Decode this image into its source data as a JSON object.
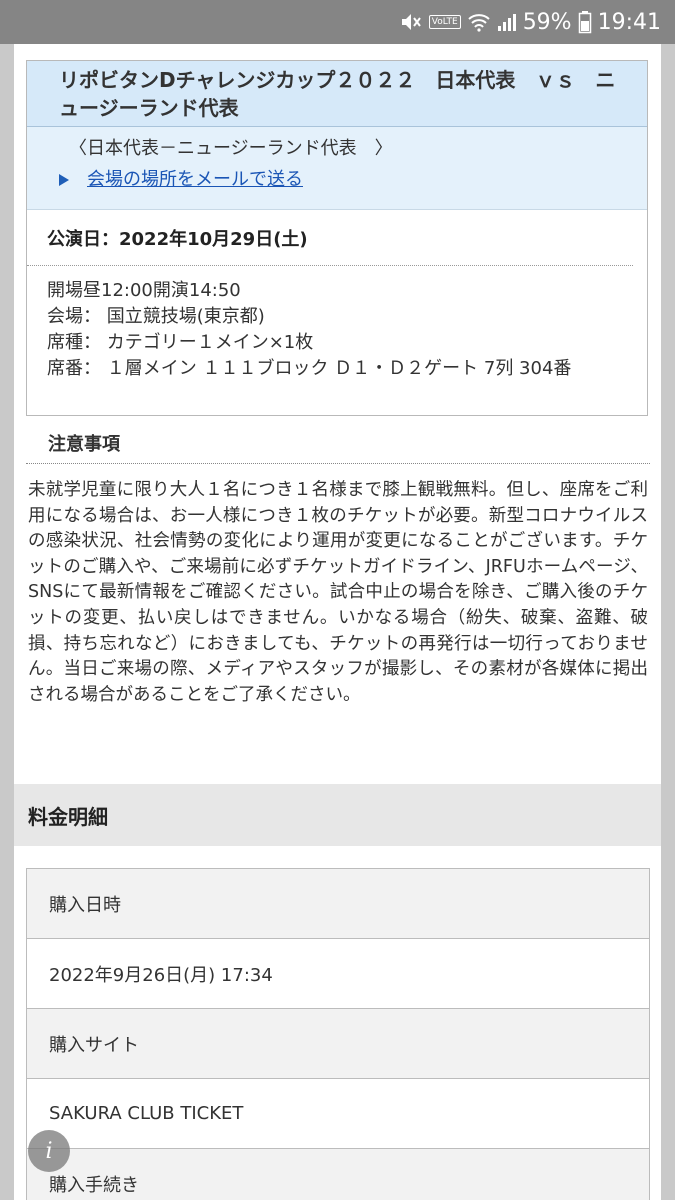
{
  "status_bar": {
    "volte": "VoLTE",
    "battery_pct": "59%",
    "time": "19:41",
    "icons": [
      "mute-icon",
      "volte-icon",
      "wifi-icon",
      "signal-icon",
      "battery-icon"
    ]
  },
  "ticket": {
    "title": "リポビタンDチャレンジカップ２０２２　日本代表　ｖｓ　ニュージーランド代表",
    "matchup": "〈日本代表－ニュージーランド代表　〉",
    "mail_link": "会場の場所をメールで送る",
    "date": "公演日：2022年10月29日(土)",
    "info": {
      "open": "開場昼12:00開演14:50",
      "venue": "会場：  国立競技場(東京都)",
      "seat_type": "席種：  カテゴリー１メイン×1枚",
      "seat_no": "席番：  １層メイン  １１１ブロック  Ｄ１・Ｄ２ゲート  7列 304番"
    }
  },
  "notes": {
    "heading": "注意事項",
    "body": "未就学児童に限り大人１名につき１名様まで膝上観戦無料。但し、座席をご利用になる場合は、お一人様につき１枚のチケットが必要。新型コロナウイルスの感染状況、社会情勢の変化により運用が変更になることがございます。チケットのご購入や、ご来場前に必ずチケットガイドライン、JRFUホームページ、SNSにて最新情報をご確認ください。試合中止の場合を除き、ご購入後のチケットの変更、払い戻しはできません。いかなる場合（紛失、破棄、盗難、破損、持ち忘れなど）におきましても、チケットの再発行は一切行っておりません。当日ご来場の際、メディアやスタッフが撮影し、その素材が各媒体に掲出される場合があることをご了承ください。"
  },
  "fee": {
    "heading": "料金明細",
    "rows": [
      {
        "label": "購入日時",
        "value": "2022年9月26日(月) 17:34"
      },
      {
        "label": "購入サイト",
        "value": "SAKURA CLUB TICKET"
      },
      {
        "label": "購入手続き"
      }
    ]
  },
  "info_button": "i"
}
